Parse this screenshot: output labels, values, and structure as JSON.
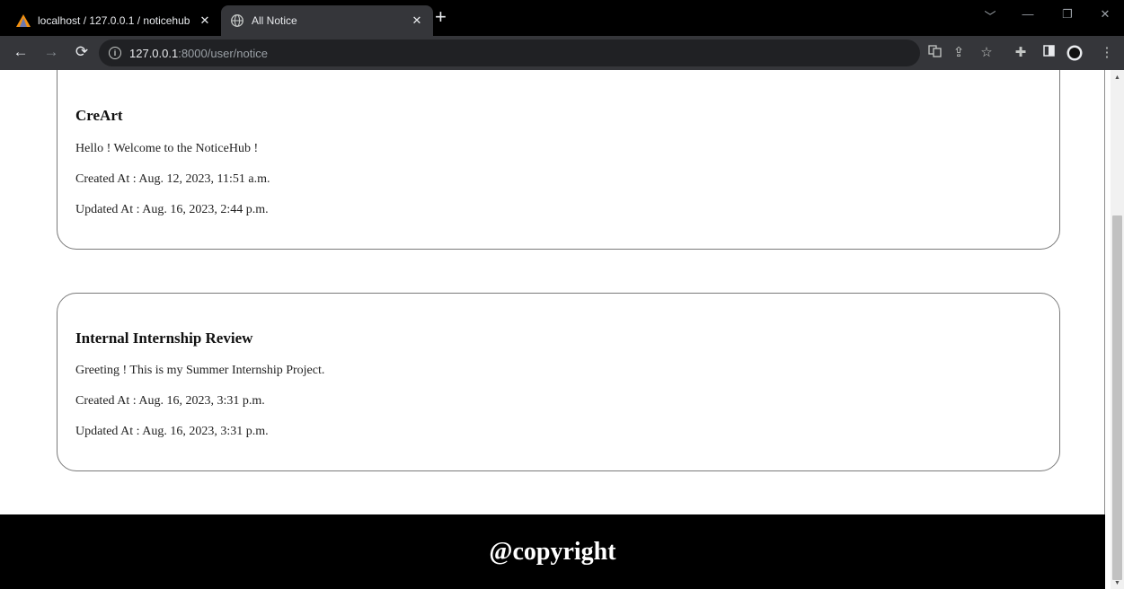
{
  "browser": {
    "tabs": [
      {
        "title": "localhost / 127.0.0.1 / noticehub",
        "favicon": "phpmyadmin-icon",
        "active": false
      },
      {
        "title": "All Notice",
        "favicon": "globe-icon",
        "active": true
      }
    ],
    "new_tab": "+",
    "url": {
      "host": "127.0.0.1",
      "path": ":8000/user/notice"
    }
  },
  "notices": [
    {
      "title": "CreArt",
      "body": "Hello ! Welcome to the NoticeHub !",
      "created": "Created At : Aug. 12, 2023, 11:51 a.m.",
      "updated": "Updated At : Aug. 16, 2023, 2:44 p.m."
    },
    {
      "title": "Internal Internship Review",
      "body": "Greeting ! This is my Summer Internship Project.",
      "created": "Created At : Aug. 16, 2023, 3:31 p.m.",
      "updated": "Updated At : Aug. 16, 2023, 3:31 p.m."
    }
  ],
  "footer": {
    "text": "@copyright"
  },
  "colors": {
    "footer_bg": "#000000",
    "tab_bar": "#000000",
    "toolbar": "#35363a"
  }
}
